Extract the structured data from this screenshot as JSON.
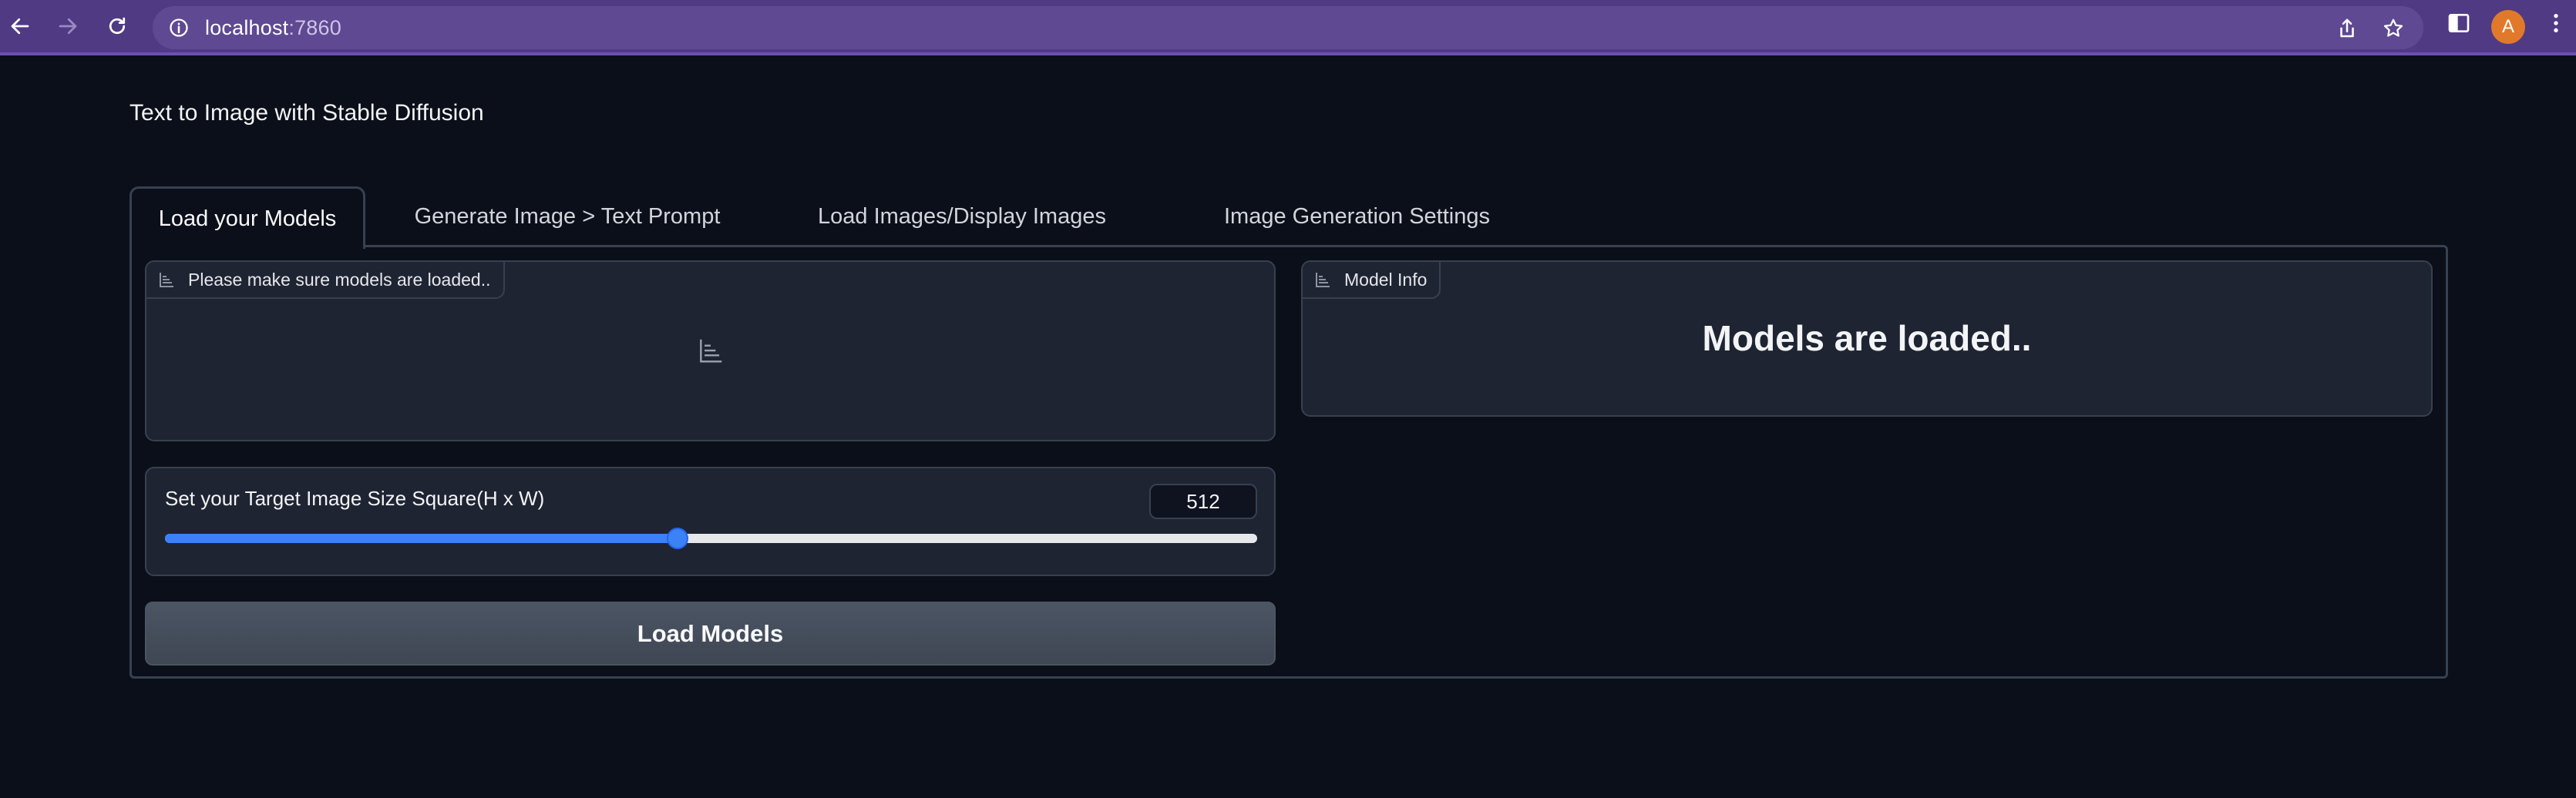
{
  "browser": {
    "url_host": "localhost",
    "url_port": ":7860",
    "avatar_letter": "A"
  },
  "app": {
    "title": "Text to Image with Stable Diffusion"
  },
  "tabs": [
    {
      "label": "Load your Models",
      "active": true
    },
    {
      "label": "Generate Image > Text Prompt",
      "active": false
    },
    {
      "label": "Load Images/Display Images",
      "active": false
    },
    {
      "label": "Image Generation Settings",
      "active": false
    }
  ],
  "left_panel": {
    "status_label": "Please make sure models are loaded..",
    "slider": {
      "label": "Set your Target Image Size Square(H x W)",
      "value": "512",
      "fill_fraction": 0.469
    },
    "load_button": "Load Models"
  },
  "right_panel": {
    "label": "Model Info",
    "message": "Models are loaded.."
  },
  "colors": {
    "browser_bar": "#4f3a83",
    "background": "#0b0f19",
    "block": "#1f2433",
    "accent": "#3b82f6",
    "avatar": "#e07a2a"
  }
}
